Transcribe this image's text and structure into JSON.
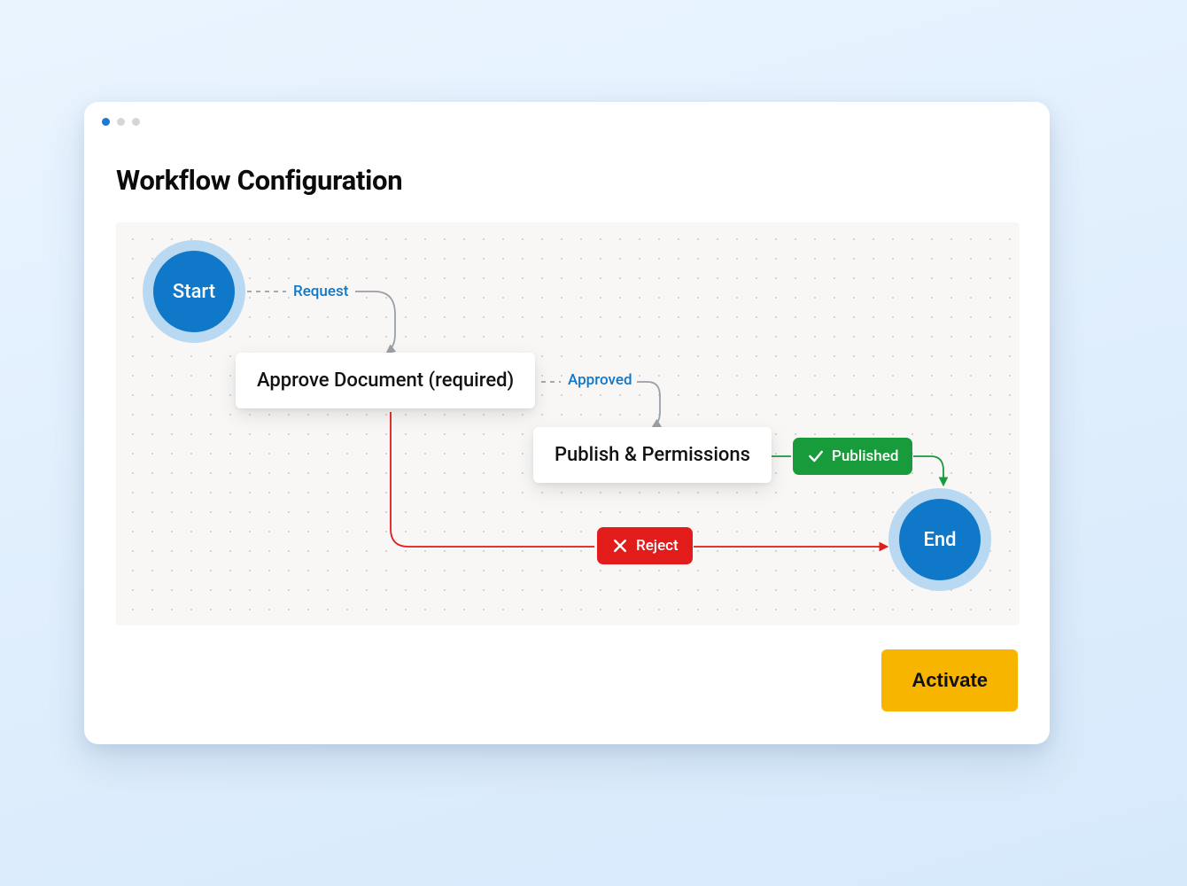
{
  "header": {
    "title": "Workflow Configuration"
  },
  "workflow": {
    "start_label": "Start",
    "end_label": "End",
    "tasks": {
      "approve": "Approve Document (required)",
      "publish": "Publish & Permissions"
    },
    "edges": {
      "request": "Request",
      "approved": "Approved",
      "published": "Published",
      "reject": "Reject"
    }
  },
  "actions": {
    "activate": "Activate"
  },
  "colors": {
    "primary_blue": "#0f78c9",
    "ring_blue": "#b9d9f2",
    "success_green": "#189b3b",
    "danger_red": "#e21b1b",
    "accent_yellow": "#f7b500"
  }
}
